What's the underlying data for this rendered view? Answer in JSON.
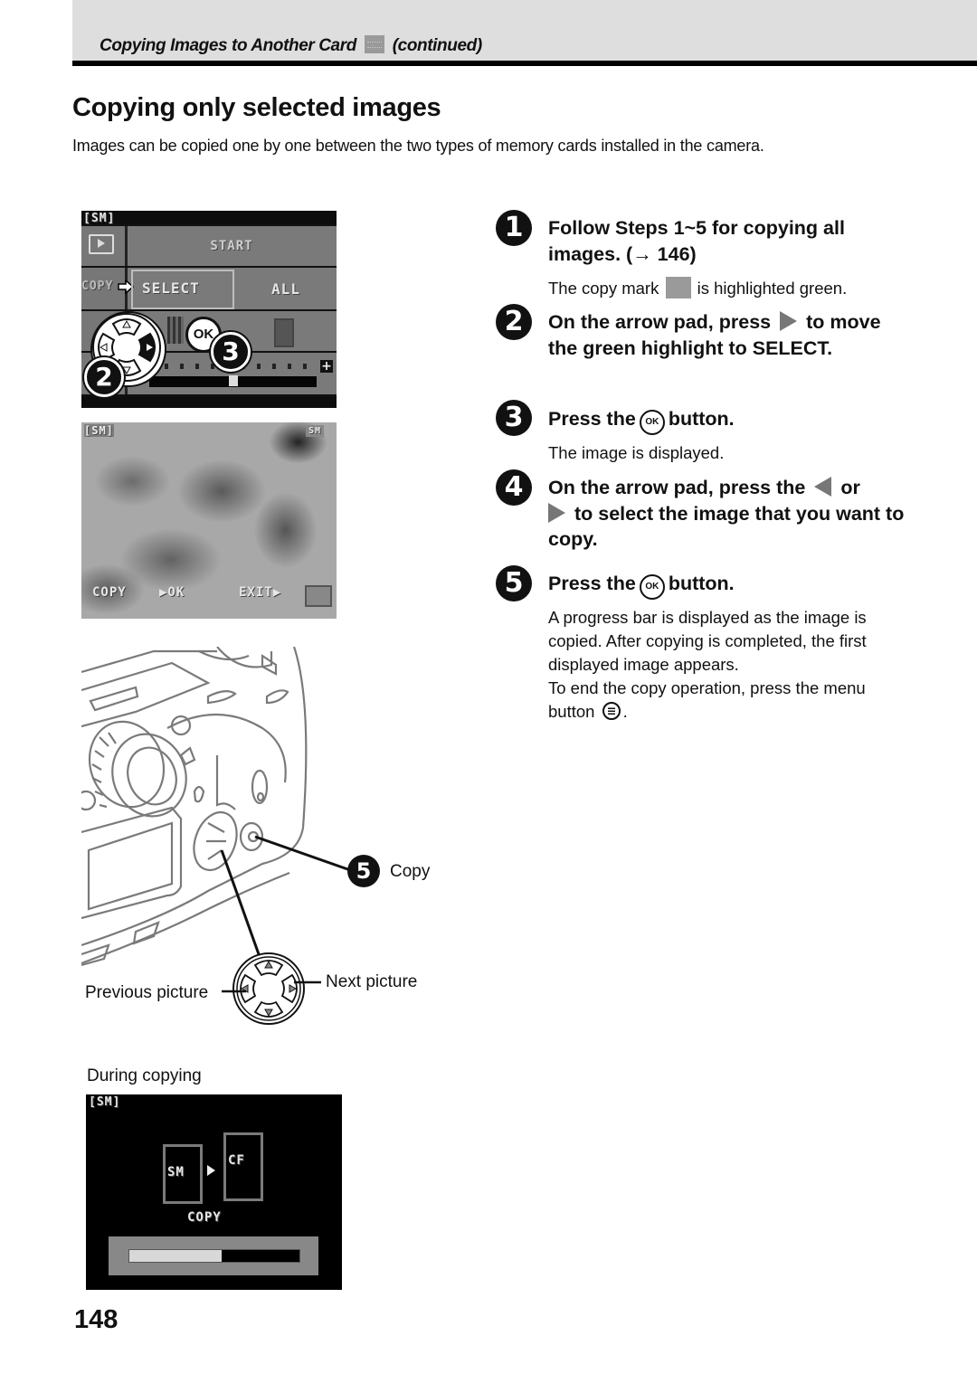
{
  "header": {
    "section_title": "Copying Images to Another Card",
    "copy_mark_icon": "copy-mark-icon",
    "continued": "(continued)"
  },
  "page_title": "Copying only selected images",
  "intro": "Images can be copied one by one between the two types of memory cards installed in the camera.",
  "screens": {
    "menu": {
      "card_label": "[SM]",
      "start": "START",
      "copy_side": "COPY",
      "select": "SELECT",
      "all": "ALL",
      "ok_badge": "OK",
      "callout_2": "2",
      "callout_3": "3",
      "brightness_level_fraction": 0.5
    },
    "photo": {
      "card_label": "[SM]",
      "card_icon_text": "SM",
      "copy_hint": "COPY",
      "ok_hint": "▶OK",
      "exit_hint": "EXIT▶"
    },
    "during_copy": {
      "card_label": "[SM]",
      "source_card": "SM",
      "dest_card": "CF",
      "status": "COPY",
      "progress_fraction": 0.54
    }
  },
  "illustration": {
    "copy_callout_num": "5",
    "copy_label": "Copy",
    "previous_label": "Previous picture",
    "next_label": "Next picture",
    "during_copying_label": "During copying"
  },
  "steps": [
    {
      "num": "1",
      "title_a": "Follow Steps 1~5 for copying all images. (→ 146)",
      "note_a": "The copy mark",
      "note_b": "is highlighted green."
    },
    {
      "num": "2",
      "title_a": "On the arrow pad, press",
      "title_b": "to move the green highlight to SELECT."
    },
    {
      "num": "3",
      "title_a": "Press the",
      "ok": "OK",
      "title_b": "button.",
      "note": "The image is displayed."
    },
    {
      "num": "4",
      "title_a": "On the arrow pad, press the",
      "title_b": "or",
      "title_c": "to select the image that you want to copy."
    },
    {
      "num": "5",
      "title_a": "Press the",
      "ok": "OK",
      "title_b": "button.",
      "note_a": "A progress bar is displayed as the image is copied. After copying is completed, the first displayed image appears.",
      "note_b": "To end the copy operation, press the menu button",
      "note_c": "."
    }
  ],
  "page_number": "148"
}
